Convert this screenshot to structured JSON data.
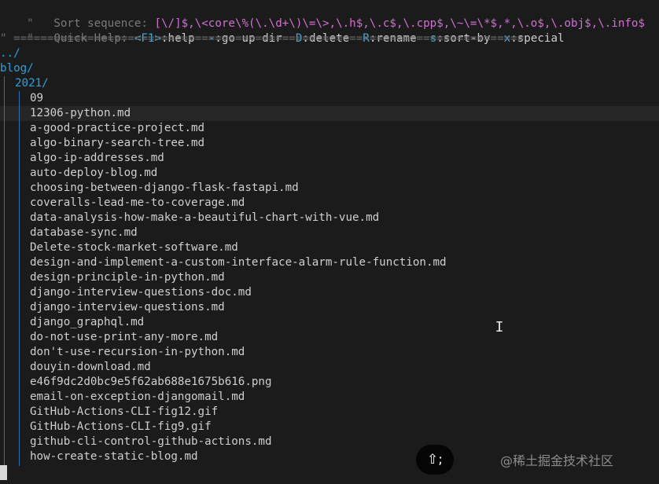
{
  "header": {
    "sort_prefix": "\"   ",
    "sort_label": "Sort sequence: ",
    "sort_value": "[\\/]$,\\<core\\%(\\.\\d+\\)\\=\\>,\\.h$,\\.c$,\\.cpp$,\\~\\=\\*$,*,\\.o$,\\.obj$,\\.info$",
    "help_prefix": "\"   ",
    "help_label": "Quick Help: ",
    "help_items": [
      {
        "key": "<F1>",
        "text": ":help  "
      },
      {
        "key": "-",
        "text": ":go up dir  "
      },
      {
        "key": "D",
        "text": ":delete  "
      },
      {
        "key": "R",
        "text": ":rename  "
      },
      {
        "key": "s",
        "text": ":sort-by  "
      },
      {
        "key": "x",
        "text": ":special"
      }
    ],
    "separator": "\" ============================================================================"
  },
  "tree": {
    "parent": "../",
    "root": "blog/",
    "subdir": "2021/",
    "files": [
      "09",
      "12306-python.md",
      "a-good-practice-project.md",
      "algo-binary-search-tree.md",
      "algo-ip-addresses.md",
      "auto-deploy-blog.md",
      "choosing-between-django-flask-fastapi.md",
      "coveralls-lead-me-to-coverage.md",
      "data-analysis-how-make-a-beautiful-chart-with-vue.md",
      "database-sync.md",
      "Delete-stock-market-software.md",
      "design-and-implement-a-custom-interface-alarm-rule-function.md",
      "design-principle-in-python.md",
      "django-interview-questions-doc.md",
      "django-interview-questions.md",
      "django_graphql.md",
      "do-not-use-print-any-more.md",
      "don't-use-recursion-in-python.md",
      "douyin-download.md",
      "e46f9dc2d0bc9e5f62ab688e1675b616.png",
      "email-on-exception-djangomail.md",
      "GitHub-Actions-CLI-fig12.gif",
      "GitHub-Actions-CLI-fig9.gif",
      "github-cli-control-github-actions.md",
      "how-create-static-blog.md"
    ]
  },
  "overlay": {
    "key_hint": "⇧;",
    "watermark": "@稀土掘金技术社区"
  },
  "colors": {
    "directory": "#2e9fd8",
    "sort_value": "#d070d0",
    "help_key": "#3fa9e0",
    "tree_guide": "#2a6fb0"
  }
}
